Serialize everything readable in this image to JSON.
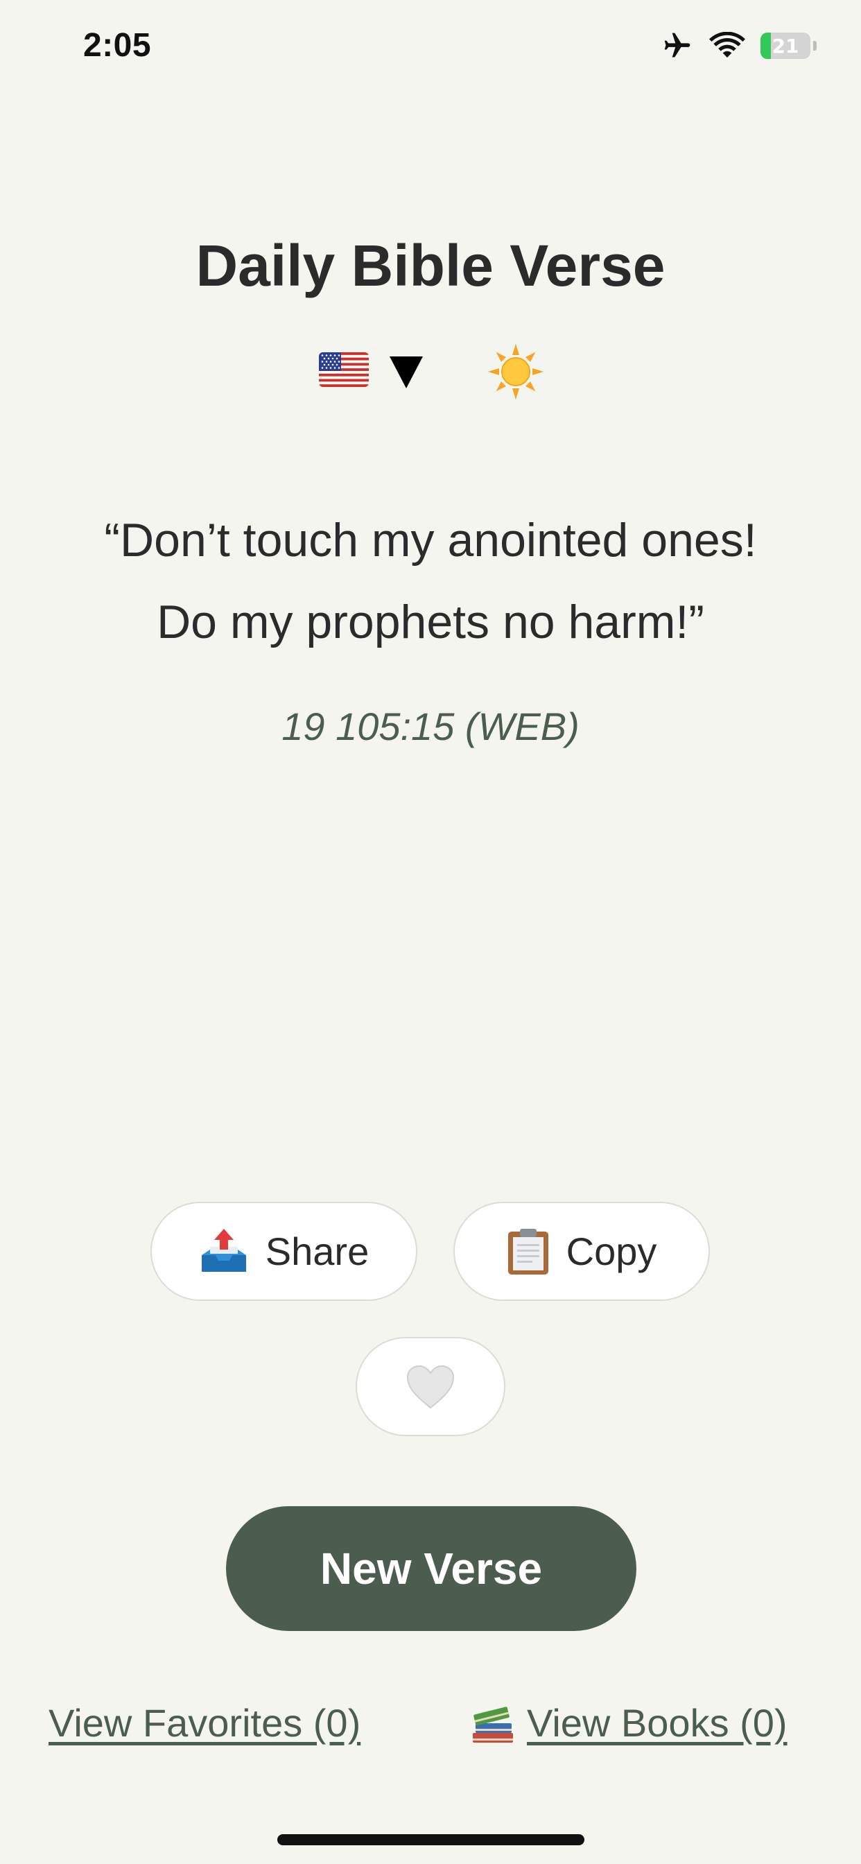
{
  "status_bar": {
    "time": "2:05",
    "battery_level": "21",
    "battery_fraction": 0.21,
    "icons": [
      "airplane-icon",
      "wifi-icon",
      "battery-icon"
    ]
  },
  "app": {
    "title": "Daily Bible Verse"
  },
  "controls": {
    "language_flag": "us-flag-icon",
    "theme_icon": "sun-icon"
  },
  "verse": {
    "line1": "“Don’t touch my anointed ones!",
    "line2": "Do my prophets no harm!”",
    "reference": "19 105:15 (WEB)"
  },
  "actions": {
    "share_label": "Share",
    "copy_label": "Copy",
    "new_verse_label": "New Verse"
  },
  "links": {
    "favorites_label": "View Favorites (0)",
    "books_label": "View Books (0)"
  },
  "colors": {
    "background": "#f5f5f0",
    "accent": "#4a5d4e",
    "text": "#2b2b2b",
    "battery_green": "#34c759"
  }
}
